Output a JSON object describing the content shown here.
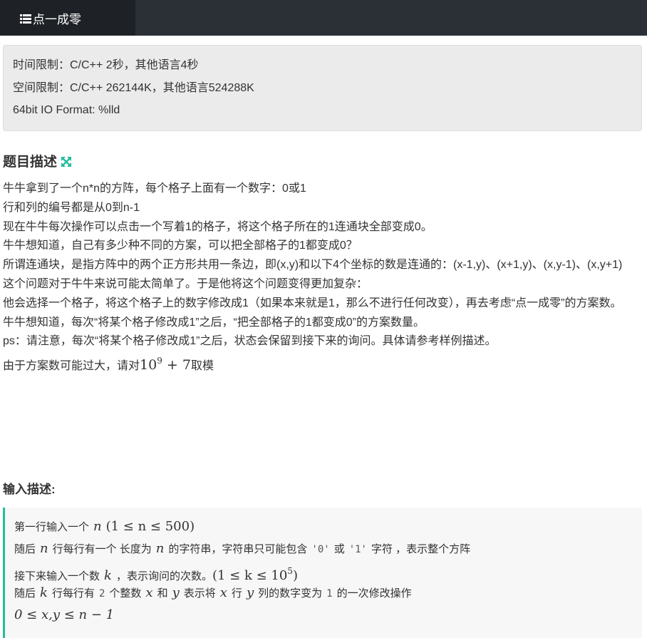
{
  "nav": {
    "title": "点一成零"
  },
  "limits": {
    "time": "时间限制：C/C++ 2秒，其他语言4秒",
    "space": "空间限制：C/C++ 262144K，其他语言524288K",
    "io": "64bit IO Format: %lld"
  },
  "description": {
    "heading": "题目描述",
    "lines": [
      "牛牛拿到了一个n*n的方阵，每个格子上面有一个数字：0或1",
      "行和列的编号都是从0到n-1",
      "现在牛牛每次操作可以点击一个写着1的格子，将这个格子所在的1连通块全部变成0。",
      "牛牛想知道，自己有多少种不同的方案，可以把全部格子的1都变成0？",
      "所谓连通块，是指方阵中的两个正方形共用一条边，即(x,y)和以下4个坐标的数是连通的：(x-1,y)、(x+1,y)、(x,y-1)、(x,y+1)",
      "这个问题对于牛牛来说可能太简单了。于是他将这个问题变得更加复杂：",
      "他会选择一个格子，将这个格子上的数字修改成1（如果本来就是1，那么不进行任何改变），再去考虑“点一成零”的方案数。",
      "牛牛想知道，每次“将某个格子修改成1”之后，“把全部格子的1都变成0”的方案数量。",
      "ps：请注意，每次“将某个格子修改成1”之后，状态会保留到接下来的询问。具体请参考样例描述。"
    ],
    "mod_prefix": "由于方案数可能过大，请对",
    "mod_base": "10",
    "mod_exp": "9",
    "mod_rest": " + 7",
    "mod_suffix": "取模"
  },
  "input": {
    "heading": "输入描述:",
    "l1_text": "第一行输入一个",
    "l1_var": "n",
    "l1_range": "(1 ≤ n ≤ 500)",
    "l2_a": "随后",
    "l2_var": "n",
    "l2_b": "行每行有一个 长度为",
    "l2_var2": "n",
    "l2_c": "的字符串，字符串只可能包含",
    "l2_code0": "'0'",
    "l2_d": "或",
    "l2_code1": "'1'",
    "l2_e": "字符 ，表示整个方阵",
    "l3_text": "接下来输入一个数",
    "l3_var": "k",
    "l3_mid": "，表示询问的次数。",
    "l3_range_pre": "(1 ≤ k ≤ 10",
    "l3_exp": "5",
    "l3_range_post": ")",
    "l4_a": "随后",
    "l4_var": "k",
    "l4_b": "行每行有",
    "l4_code": "2",
    "l4_c": "个整数",
    "l4_x": "x",
    "l4_and": "和",
    "l4_y": "y",
    "l4_d": "表示将",
    "l4_x2": "x",
    "l4_e": "行",
    "l4_y2": "y",
    "l4_f": "列的数字变为",
    "l4_code1": "1",
    "l4_g": "的一次修改操作",
    "l5_math": "0 ≤ x,y ≤ n − 1"
  },
  "colors": {
    "topbar": "#2a3036",
    "active_tab": "#1e2226",
    "accent": "#25bb9b"
  }
}
